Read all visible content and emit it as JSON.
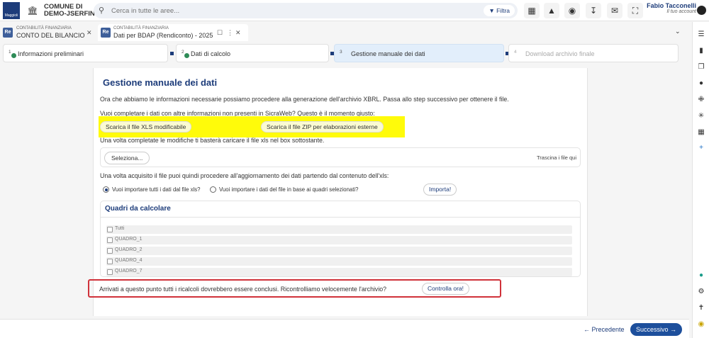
{
  "header": {
    "logo_text": "Maggioli",
    "org_line1": "COMUNE DI",
    "org_line2": "DEMO-JSERFIN",
    "search_placeholder": "Cerca in tutte le aree...",
    "filter_label": "Filtra",
    "user_name": "Fabio Tacconelli",
    "user_role": "Il tuo account"
  },
  "tabs": [
    {
      "icon": "Re",
      "subtitle": "CONTABILITÀ FINANZIARIA",
      "title": "CONTO DEL BILANCIO"
    },
    {
      "icon": "Re",
      "subtitle": "CONTABILITÀ FINANZIARIA",
      "title": "Dati per BDAP (Rendiconto) - 2025"
    }
  ],
  "steps": [
    {
      "num": "1",
      "label": "Informazioni preliminari",
      "status": "done"
    },
    {
      "num": "2",
      "label": "Dati di calcolo",
      "status": "done"
    },
    {
      "num": "3",
      "label": "Gestione manuale dei dati",
      "status": "active"
    },
    {
      "num": "4",
      "label": "Download archivio finale",
      "status": "disabled"
    }
  ],
  "main": {
    "title": "Gestione manuale dei dati",
    "intro": "Ora che abbiamo le informazioni necessarie possiamo procedere alla generazione dell'archivio XBRL. Passa allo step successivo per ottenere il file.",
    "question": "Vuoi completare i dati con altre informazioni non presenti in SicraWeb? Questo è il momento giusto:",
    "btn_xls": "Scarica il file XLS modificabile",
    "btn_zip": "Scarica il file ZIP per elaborazioni esterne",
    "upload_hint": "Una volta completate le modifiche ti basterà caricare il file xls nel box sottostante.",
    "select_btn": "Seleziona...",
    "drag_hint": "Trascina i file qui",
    "update_text": "Una volta acquisito il file puoi quindi procedere all'aggiornamento dei dati partendo dal contenuto dell'xls:",
    "radio_all": "Vuoi importare tutti i dati dal file xls?",
    "radio_selected": "Vuoi importare i dati del file in base ai quadri selezionati?",
    "import_btn": "Importa!",
    "quadri_title": "Quadri da calcolare",
    "quadri": [
      "Tutti",
      "QUADRO_1",
      "QUADRO_2",
      "QUADRO_4",
      "QUADRO_7"
    ],
    "final_text": "Arrivati a questo punto tutti i ricalcoli dovrebbero essere conclusi. Ricontrolliamo velocemente l'archivio?",
    "check_btn": "Controlla ora!"
  },
  "footer": {
    "prev_label": "Precedente",
    "next_label": "Successivo"
  },
  "colors": {
    "brand": "#1d3c7a",
    "highlight": "#fffb0a",
    "alert_border": "#d0323a",
    "success": "#2e8b57"
  }
}
